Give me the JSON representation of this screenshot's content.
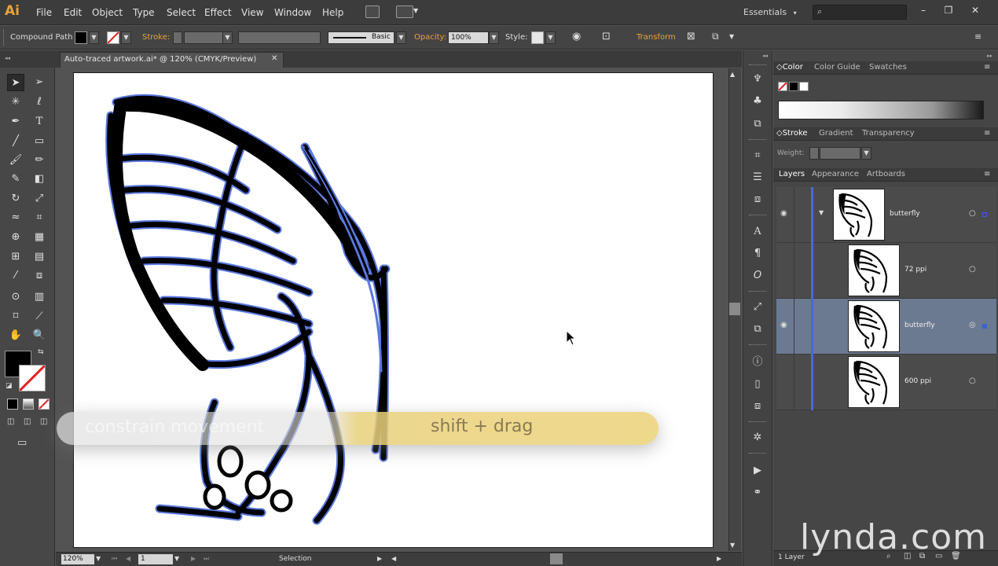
{
  "app": {
    "logo": "Ai"
  },
  "menu": [
    "File",
    "Edit",
    "Object",
    "Type",
    "Select",
    "Effect",
    "View",
    "Window",
    "Help"
  ],
  "workspace": {
    "label": "Essentials",
    "arrow": "▾"
  },
  "window_controls": {
    "minimize": "–",
    "restore": "❐",
    "close": "✕"
  },
  "controlbar": {
    "selection_type": "Compound Path",
    "stroke_label": "Stroke:",
    "brush_label": "Basic",
    "opacity_label": "Opacity:",
    "opacity_value": "100%",
    "style_label": "Style:",
    "transform_label": "Transform"
  },
  "document": {
    "tab_title": "Auto-traced artwork.ai* @ 120% (CMYK/Preview)",
    "close": "✕"
  },
  "status": {
    "zoom": "120%",
    "page": "1",
    "tool": "Selection"
  },
  "panels": {
    "color_tabs": [
      "Color",
      "Color Guide",
      "Swatches"
    ],
    "stroke_tabs": [
      "Stroke",
      "Gradient",
      "Transparency"
    ],
    "weight_label": "Weight:",
    "layers_tabs": [
      "Layers",
      "Appearance",
      "Artboards"
    ]
  },
  "layers": [
    {
      "name": "butterfly",
      "visible": true,
      "expanded": true,
      "selected": false,
      "level": 0
    },
    {
      "name": "72 ppi",
      "visible": false,
      "selected": false,
      "level": 1
    },
    {
      "name": "butterfly",
      "visible": true,
      "selected": true,
      "level": 1
    },
    {
      "name": "600 ppi",
      "visible": false,
      "selected": false,
      "level": 1
    }
  ],
  "layers_footer": "1 Layer",
  "overlay": {
    "left_text": "constrain movement",
    "right_text": "shift + drag"
  },
  "watermark": "lynda.com",
  "colors": {
    "accent_orange": "#e8a23a",
    "selection_blue": "#4a6ad0",
    "layer_highlight": "#6c7a91"
  },
  "icons": {
    "tools": [
      "selection-tool",
      "direct-selection-tool",
      "magic-wand-tool",
      "lasso-tool",
      "pen-tool",
      "type-tool",
      "line-tool",
      "rectangle-tool",
      "paintbrush-tool",
      "pencil-tool",
      "blob-brush-tool",
      "eraser-tool",
      "rotate-tool",
      "scale-tool",
      "width-tool",
      "free-transform-tool",
      "shape-builder-tool",
      "perspective-grid-tool",
      "mesh-tool",
      "gradient-tool",
      "eyedropper-tool",
      "blend-tool",
      "symbol-sprayer-tool",
      "column-graph-tool",
      "artboard-tool",
      "slice-tool",
      "hand-tool",
      "zoom-tool"
    ]
  }
}
